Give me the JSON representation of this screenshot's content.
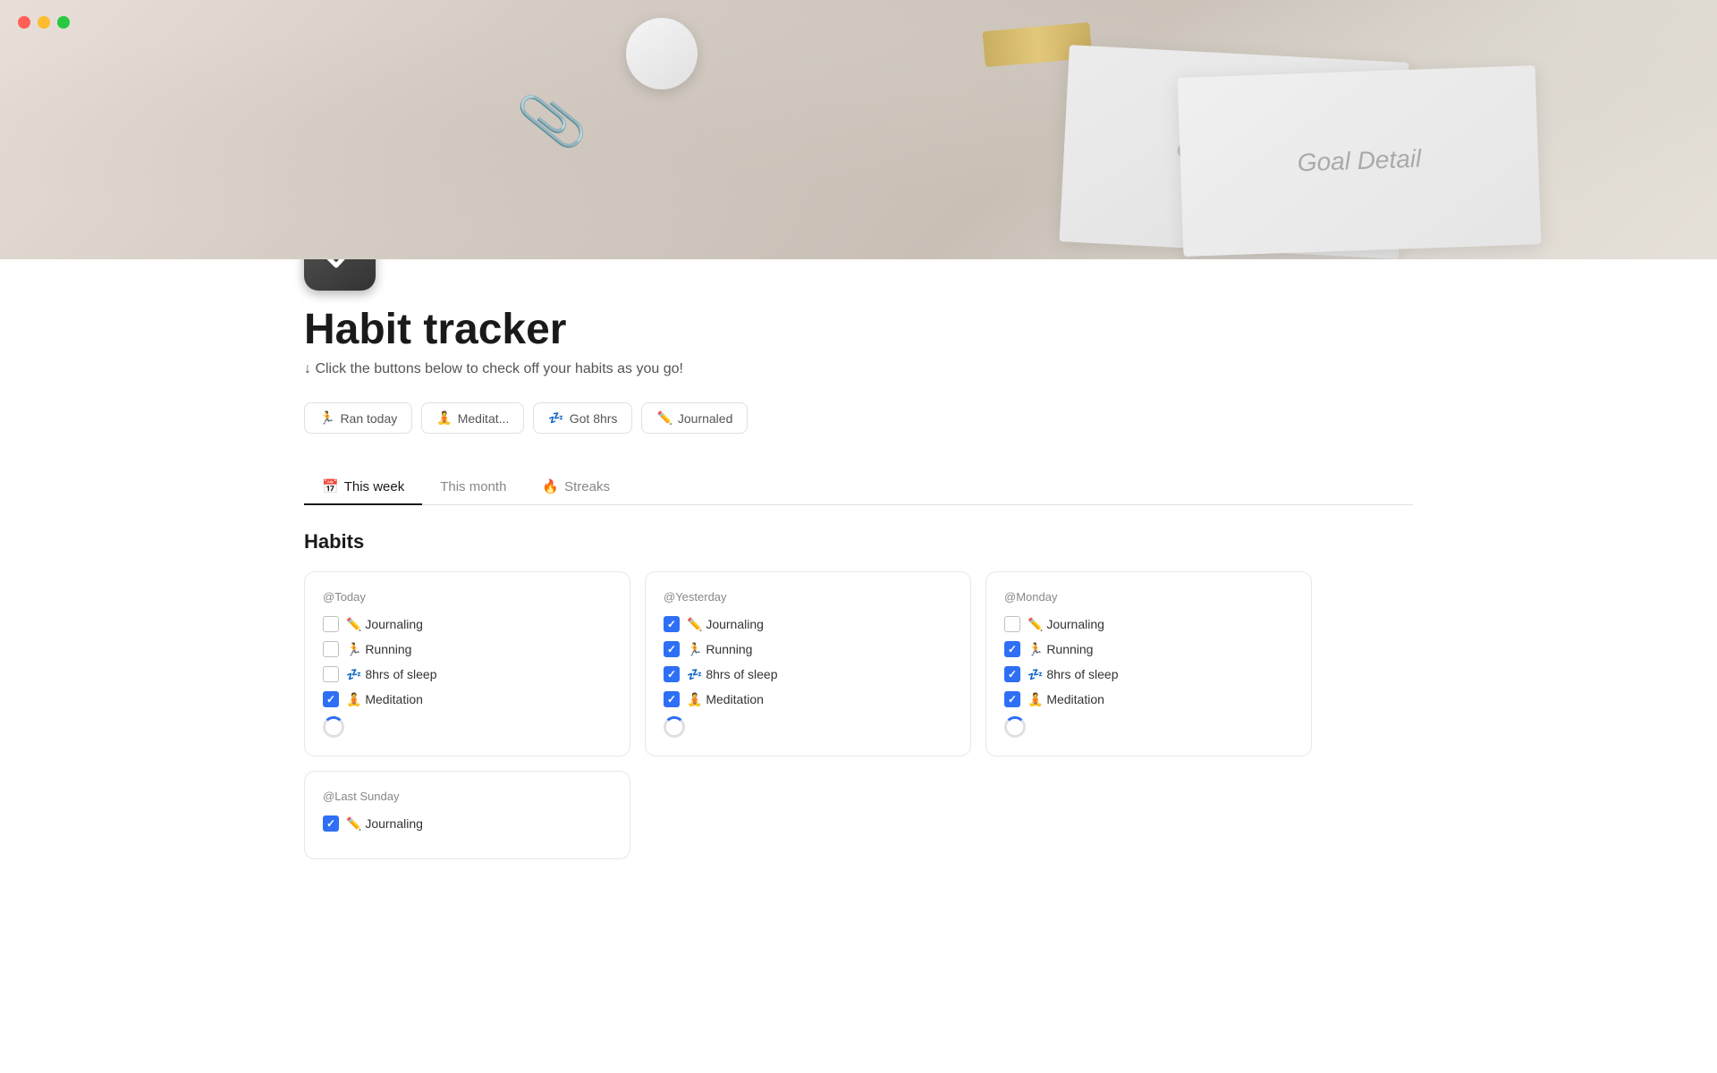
{
  "window": {
    "title": "Habit tracker"
  },
  "traffic_lights": {
    "red_label": "close",
    "yellow_label": "minimize",
    "green_label": "maximize"
  },
  "header": {
    "title": "Habit tracker",
    "subtitle": "↓ Click the buttons below to check off your habits as you go!"
  },
  "quick_actions": [
    {
      "id": "ran-today",
      "icon": "🏃",
      "label": "Ran today"
    },
    {
      "id": "meditated",
      "icon": "🧘",
      "label": "Meditat..."
    },
    {
      "id": "got-8hrs",
      "icon": "💤",
      "label": "Got 8hrs"
    },
    {
      "id": "journaled",
      "icon": "✏️",
      "label": "Journaled"
    }
  ],
  "tabs": [
    {
      "id": "this-week",
      "label": "This week",
      "icon": "📅",
      "active": true
    },
    {
      "id": "this-month",
      "label": "This month",
      "icon": "",
      "active": false
    },
    {
      "id": "streaks",
      "label": "Streaks",
      "icon": "🔥",
      "active": false
    }
  ],
  "section_title": "Habits",
  "cards": [
    {
      "id": "today",
      "date_label": "@Today",
      "habits": [
        {
          "id": "journal-today",
          "label": "✏️ Journaling",
          "checked": false
        },
        {
          "id": "running-today",
          "label": "🏃 Running",
          "checked": false
        },
        {
          "id": "sleep-today",
          "label": "💤 8hrs of sleep",
          "checked": false
        },
        {
          "id": "meditation-today",
          "label": "🧘 Meditation",
          "checked": true
        }
      ],
      "loading": true
    },
    {
      "id": "yesterday",
      "date_label": "@Yesterday",
      "habits": [
        {
          "id": "journal-yesterday",
          "label": "✏️ Journaling",
          "checked": true
        },
        {
          "id": "running-yesterday",
          "label": "🏃 Running",
          "checked": true
        },
        {
          "id": "sleep-yesterday",
          "label": "💤 8hrs of sleep",
          "checked": true
        },
        {
          "id": "meditation-yesterday",
          "label": "🧘 Meditation",
          "checked": true
        }
      ],
      "loading": true
    },
    {
      "id": "monday",
      "date_label": "@Monday",
      "habits": [
        {
          "id": "journal-monday",
          "label": "✏️ Journaling",
          "checked": false
        },
        {
          "id": "running-monday",
          "label": "🏃 Running",
          "checked": true
        },
        {
          "id": "sleep-monday",
          "label": "💤 8hrs of sleep",
          "checked": true
        },
        {
          "id": "meditation-monday",
          "label": "🧘 Meditation",
          "checked": true
        }
      ],
      "loading": true
    },
    {
      "id": "last-sunday",
      "date_label": "@Last Sunday",
      "habits": [
        {
          "id": "journal-sunday",
          "label": "✏️ Journaling",
          "checked": true
        }
      ],
      "loading": false
    }
  ]
}
